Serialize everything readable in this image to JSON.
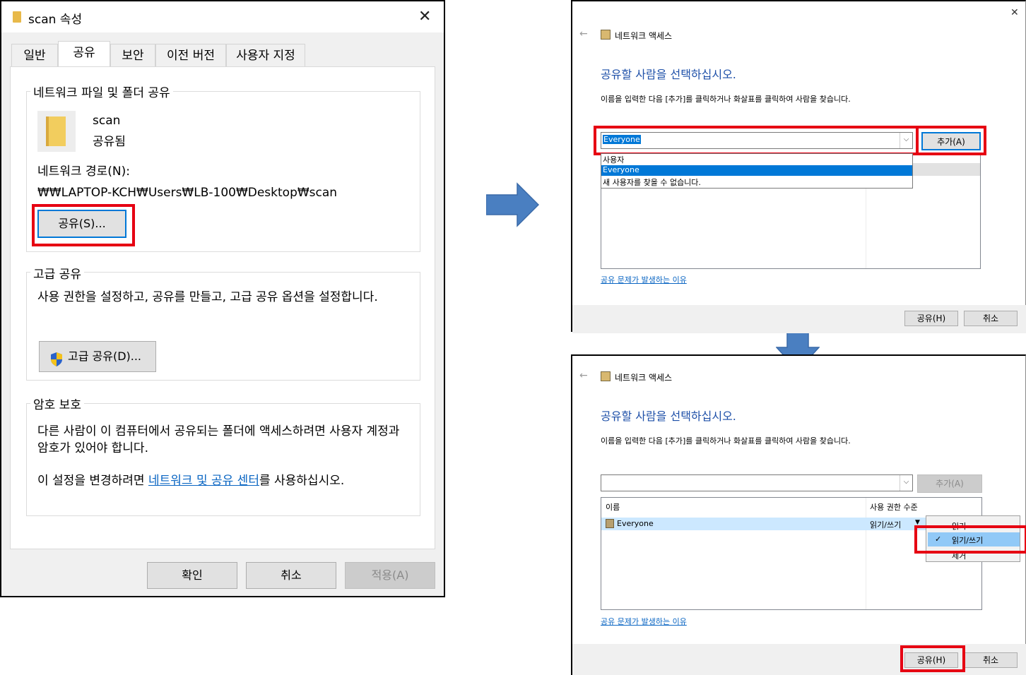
{
  "properties": {
    "title": "scan 속성",
    "tabs": [
      "일반",
      "공유",
      "보안",
      "이전 버전",
      "사용자 지정"
    ],
    "network_share": {
      "group_title": "네트워크 파일 및 폴더 공유",
      "folder_name": "scan",
      "status": "공유됨",
      "path_label": "네트워크 경로(N):",
      "path": "₩₩LAPTOP-KCH₩Users₩LB-100₩Desktop₩scan",
      "share_button": "공유(S)..."
    },
    "advanced_share": {
      "group_title": "고급 공유",
      "description": "사용 권한을 설정하고, 공유를 만들고, 고급 공유 옵션을 설정합니다.",
      "button": "고급 공유(D)..."
    },
    "password": {
      "group_title": "암호 보호",
      "description": "다른 사람이 이 컴퓨터에서 공유되는 폴더에 액세스하려면 사용자 계정과 암호가 있어야 합니다.",
      "pre_link": "이 설정을 변경하려면 ",
      "link": "네트워크 및 공유 센터",
      "post_link": "를 사용하십시오."
    },
    "footer": {
      "ok": "확인",
      "cancel": "취소",
      "apply": "적용(A)"
    }
  },
  "network_access_top": {
    "title": "네트워크 액세스",
    "heading": "공유할 사람을 선택하십시오.",
    "instruction": "이름을 입력한 다음 [추가]를 클릭하거나 화살표를 클릭하여 사람을 찾습니다.",
    "combo_value": "Everyone",
    "add_button": "추가(A)",
    "dropdown_items": [
      "사용자",
      "Everyone",
      "새 사용자를 찾을 수 없습니다."
    ],
    "help_link": "공유 문제가 발생하는 이유",
    "share_button": "공유(H)",
    "cancel_button": "취소"
  },
  "network_access_bottom": {
    "title": "네트워크 액세스",
    "heading": "공유할 사람을 선택하십시오.",
    "instruction": "이름을 입력한 다음 [추가]를 클릭하거나 화살표를 클릭하여 사람을 찾습니다.",
    "combo_value": "",
    "add_button": "추가(A)",
    "columns": [
      "이름",
      "사용 권한 수준"
    ],
    "row": {
      "name": "Everyone",
      "permission": "읽기/쓰기"
    },
    "permission_menu": [
      "읽기",
      "읽기/쓰기",
      "제거"
    ],
    "checked_item": "읽기/쓰기",
    "help_link": "공유 문제가 발생하는 이유",
    "share_button": "공유(H)",
    "cancel_button": "취소"
  },
  "colors": {
    "highlight_red": "#e60012",
    "arrow_blue": "#4a7fc1",
    "heading_blue": "#1d4fa8",
    "selection_blue": "#0078d7"
  }
}
